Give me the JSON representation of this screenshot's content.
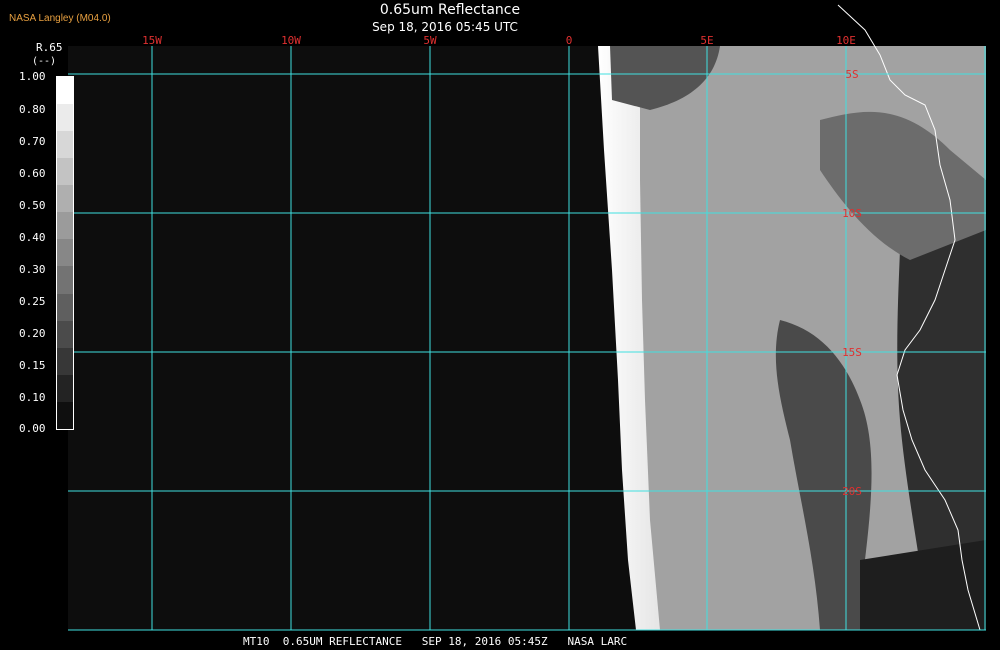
{
  "header": {
    "brand": "NASA Langley (M04.0)",
    "title": "0.65um Reflectance",
    "subtitle": "Sep 18, 2016 05:45 UTC"
  },
  "colorbar": {
    "variable": "R.65",
    "unit": "(--)",
    "labels": [
      "1.00",
      "0.80",
      "0.70",
      "0.60",
      "0.50",
      "0.40",
      "0.30",
      "0.25",
      "0.20",
      "0.15",
      "0.10",
      "0.00"
    ],
    "shades": [
      "#ffffff",
      "#ebebeb",
      "#d7d7d7",
      "#c3c3c3",
      "#afafaf",
      "#9b9b9b",
      "#878787",
      "#737373",
      "#5f5f5f",
      "#4b4b4b",
      "#373737",
      "#232323",
      "#0f0f0f"
    ]
  },
  "map": {
    "longitude_labels": [
      "15W",
      "10W",
      "5W",
      "0",
      "5E",
      "10E"
    ],
    "latitude_labels": [
      "5S",
      "10S",
      "15S",
      "20S"
    ],
    "grid_color": "#40e0e0",
    "label_color": "#e03030",
    "coast_color": "#ffffff"
  },
  "footer": {
    "text": "MT10  0.65UM REFLECTANCE   SEP 18, 2016 05:45Z   NASA LARC"
  }
}
